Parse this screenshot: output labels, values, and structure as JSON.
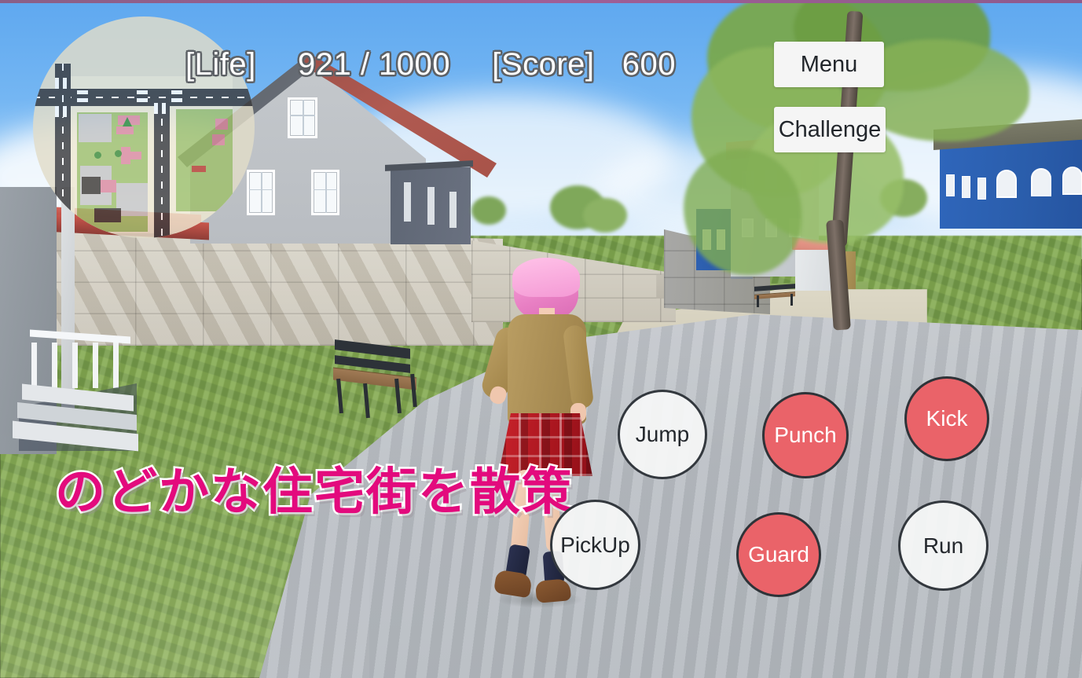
{
  "hud": {
    "life_label": "[Life]",
    "life_value": "921 / 1000",
    "score_label": "[Score]",
    "score_value": "600"
  },
  "menu_buttons": [
    {
      "id": "menu",
      "label": "Menu"
    },
    {
      "id": "challenge",
      "label": "Challenge"
    }
  ],
  "action_buttons": [
    {
      "id": "jump",
      "label": "Jump",
      "style": "light"
    },
    {
      "id": "punch",
      "label": "Punch",
      "style": "red"
    },
    {
      "id": "kick",
      "label": "Kick",
      "style": "red"
    },
    {
      "id": "pickup",
      "label": "PickUp",
      "style": "light"
    },
    {
      "id": "guard",
      "label": "Guard",
      "style": "red"
    },
    {
      "id": "run",
      "label": "Run",
      "style": "light"
    }
  ],
  "subtitle": {
    "text": "のどかな住宅街を散策"
  },
  "colors": {
    "button_red": "#ea6369",
    "button_light": "#f6f7f8",
    "button_border": "#33383e",
    "menu_bg": "#f5f5f5",
    "menu_text": "#22262b",
    "hud_text": "#ffffff",
    "hud_outline": "#5d6166",
    "subtitle_fill": "#e30a7d",
    "subtitle_stroke": "#ffffff",
    "sky_top": "#5fa8ef",
    "grass": "#8cb05c",
    "pavement": "#c2c6cb",
    "house_roof": "#a85349",
    "blue_building": "#2a5dab"
  },
  "minimap": {
    "label": "minimap"
  },
  "scene": {
    "character": "girl-pink-hair-khaki-cardigan-red-plaid-skirt",
    "props": [
      "park-bench-left",
      "park-bench-right",
      "tree-large",
      "concrete-walls",
      "grey-house",
      "blue-building"
    ]
  }
}
